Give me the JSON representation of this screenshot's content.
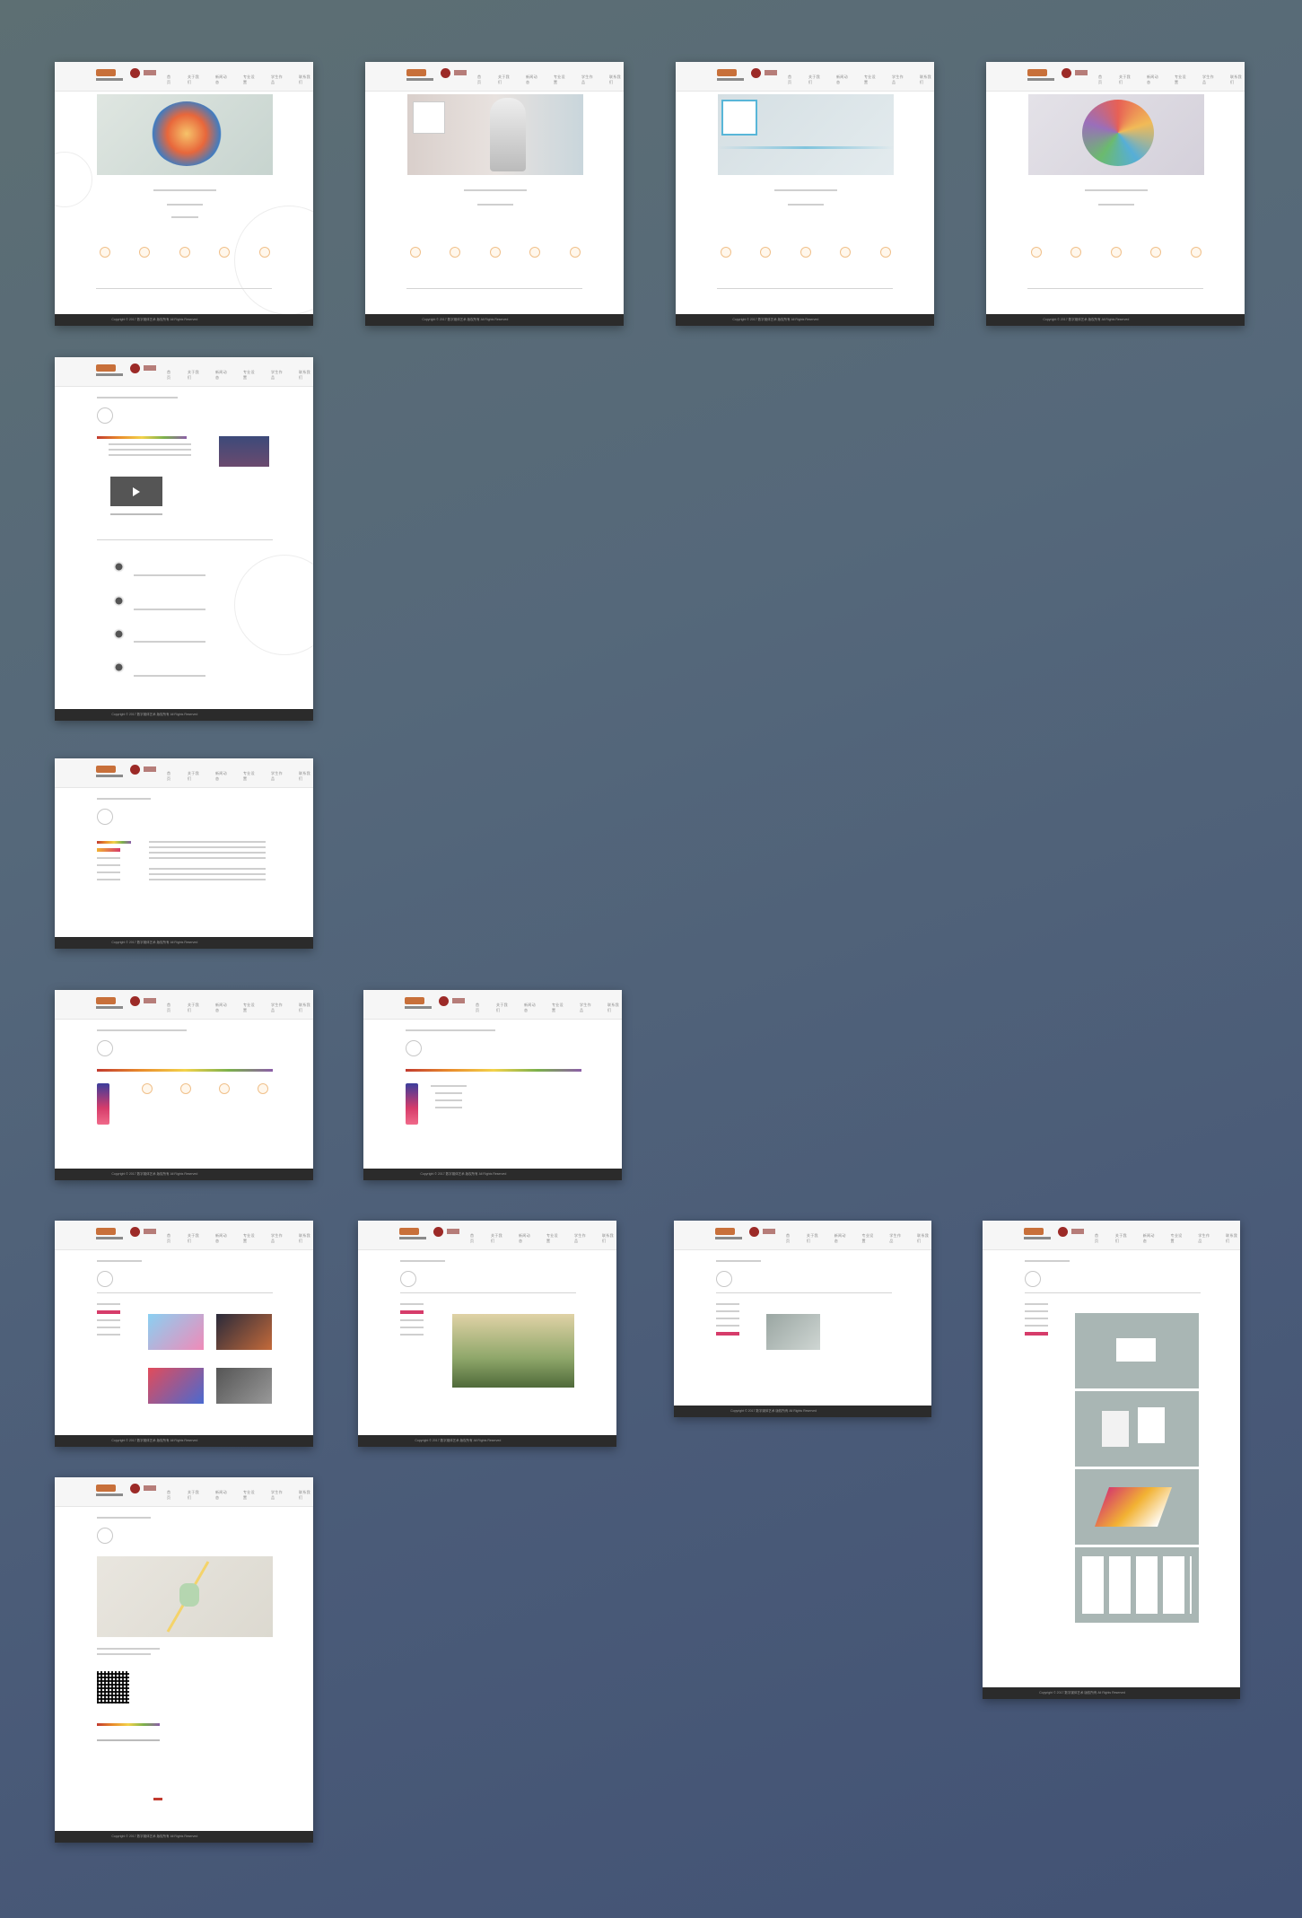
{
  "nav": {
    "items": [
      "首页",
      "关于我们",
      "新闻动态",
      "专业设置",
      "学生作品",
      "联系我们"
    ]
  },
  "footer": {
    "copyright": "Copyright © 2017 数字媒体艺术 版权所有  All Rights Reserved"
  },
  "colors": {
    "background_top": "#5d6f73",
    "background_bottom": "#425274",
    "accent": "#d63c6a",
    "footer": "#2b2b2b",
    "seal": "#9c2a27"
  },
  "icons": [
    "play-icon",
    "social-share-icon",
    "scroll-top-icon",
    "qr-code-icon"
  ]
}
